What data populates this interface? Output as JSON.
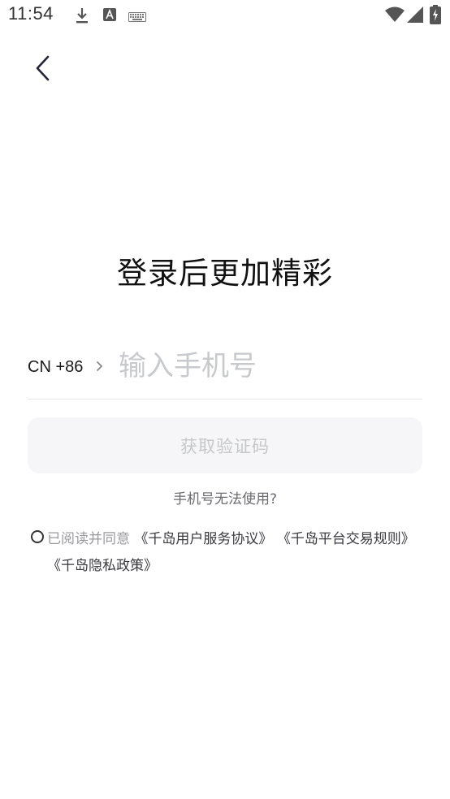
{
  "status_bar": {
    "time": "11:54",
    "icons": [
      "download-icon",
      "a-badge-icon",
      "keyboard-icon",
      "wifi-icon",
      "signal-icon",
      "battery-charging-icon"
    ]
  },
  "nav": {
    "back_icon": "chevron-left-icon"
  },
  "headline": "登录后更加精彩",
  "phone": {
    "country_code": "CN +86",
    "placeholder": "输入手机号",
    "value": ""
  },
  "code_button_label": "获取验证码",
  "help_link": "手机号无法使用?",
  "agreement": {
    "checked": false,
    "prefix": "已阅读并同意",
    "links": [
      "《千岛用户服务协议》",
      "《千岛平台交易规则》",
      "《千岛隐私政策》"
    ]
  },
  "colors": {
    "placeholder": "#c8c9cc",
    "button_bg": "#f6f6f8",
    "button_text": "#c6c7cb",
    "divider": "#e6e6e8",
    "muted_text": "#9a9a9f"
  }
}
